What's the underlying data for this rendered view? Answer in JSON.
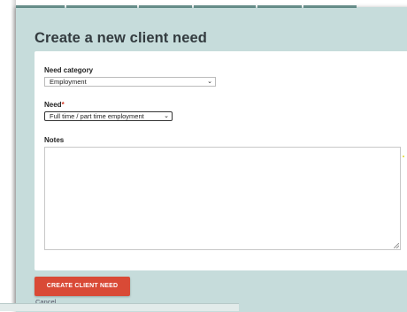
{
  "form": {
    "title": "Create a new client need",
    "category_label": "Need category",
    "category_value": "Employment",
    "need_label": "Need",
    "need_required_mark": "*",
    "need_value": "Full time / part time employment",
    "notes_label": "Notes",
    "notes_value": "",
    "submit_label": "CREATE CLIENT NEED",
    "cancel_label": "Cancel"
  },
  "icons": {
    "select_chevron": "chevron-down-icon",
    "resize_handle": "resize-grip-icon"
  },
  "colors": {
    "panel_bg": "#c6dcdb",
    "card_bg": "#ffffff",
    "primary_button": "#d94a36",
    "required_marker": "#d23c2a",
    "title_text": "#333b3f"
  }
}
